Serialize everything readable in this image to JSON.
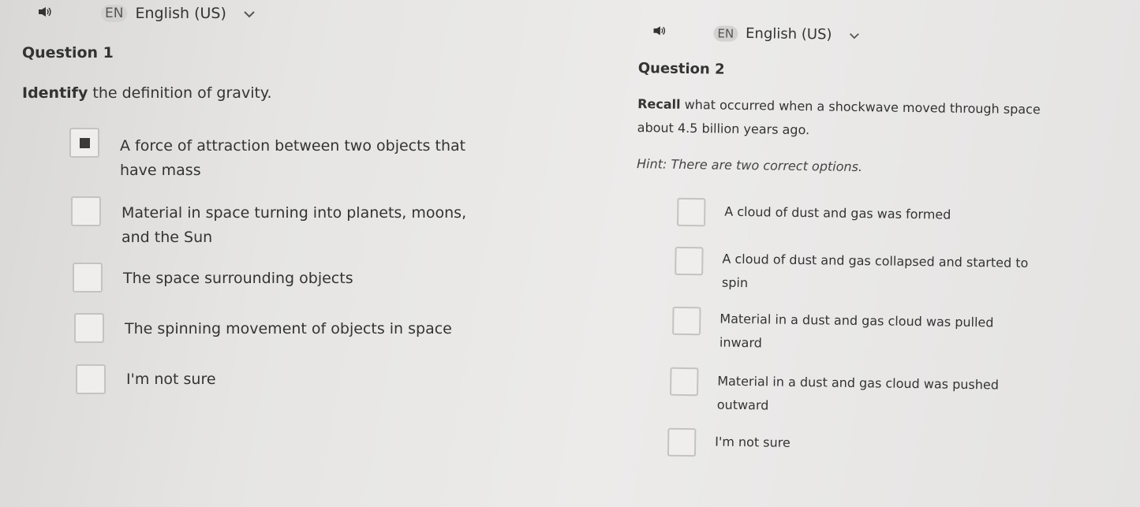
{
  "q1": {
    "language": {
      "code": "EN",
      "name": "English (US)"
    },
    "title": "Question 1",
    "prompt_keyword": "Identify",
    "prompt_rest": " the definition of gravity.",
    "options": [
      {
        "line1": "A force of attraction between two objects that",
        "line2": "have mass",
        "checked": true
      },
      {
        "line1": "Material in space turning into planets, moons,",
        "line2": "and the Sun",
        "checked": false
      },
      {
        "line1": "The space surrounding objects",
        "line2": "",
        "checked": false
      },
      {
        "line1": "The spinning movement of objects in space",
        "line2": "",
        "checked": false
      },
      {
        "line1": "I'm not sure",
        "line2": "",
        "checked": false
      }
    ]
  },
  "q2": {
    "language": {
      "code": "EN",
      "name": "English (US)"
    },
    "title": "Question 2",
    "prompt_keyword": "Recall",
    "prompt_rest_line1": " what occurred when a shockwave moved through space",
    "prompt_line2": "about 4.5 billion years ago.",
    "hint": "Hint: There are two correct options.",
    "options": [
      {
        "line1": "A cloud of dust and gas was formed",
        "line2": "",
        "checked": false
      },
      {
        "line1": "A cloud of dust and gas collapsed and started to",
        "line2": "spin",
        "checked": false
      },
      {
        "line1": "Material in a dust and gas cloud was pulled",
        "line2": "inward",
        "checked": false
      },
      {
        "line1": "Material in a dust and gas cloud was pushed",
        "line2": "outward",
        "checked": false
      },
      {
        "line1": "I'm not sure",
        "line2": "",
        "checked": false
      }
    ]
  },
  "icons": {
    "speaker": "speaker-icon",
    "chevron": "chevron-down-icon"
  }
}
